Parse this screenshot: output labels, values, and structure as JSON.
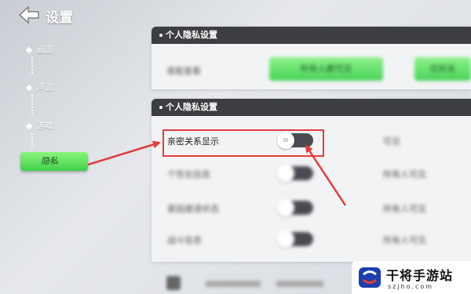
{
  "header": {
    "title": "设置"
  },
  "sidebar": {
    "items": [
      {
        "label": "画面"
      },
      {
        "label": "声音"
      },
      {
        "label": "游戏"
      },
      {
        "label": "隐私"
      }
    ]
  },
  "panel_top": {
    "title": "个人隐私设置",
    "row_label": "谁能查看",
    "buttons": [
      "所有人都可见",
      "仅好友"
    ]
  },
  "panel_main": {
    "title": "个人隐私设置",
    "rows": [
      {
        "label": "亲密关系显示",
        "right": "可见"
      },
      {
        "label": "个性化信息",
        "right": "所有人可见"
      },
      {
        "label": "家园邀请状态",
        "right": "所有人可见"
      },
      {
        "label": "战斗信息",
        "right": "所有人可见"
      }
    ],
    "toggle_knob_text": "III"
  },
  "watermark": {
    "name": "干将手游站",
    "url": "szjho.com"
  },
  "colors": {
    "accent_green": "#49d25a",
    "highlight_red": "#e23b3b",
    "header_dark": "#3d3e42"
  }
}
